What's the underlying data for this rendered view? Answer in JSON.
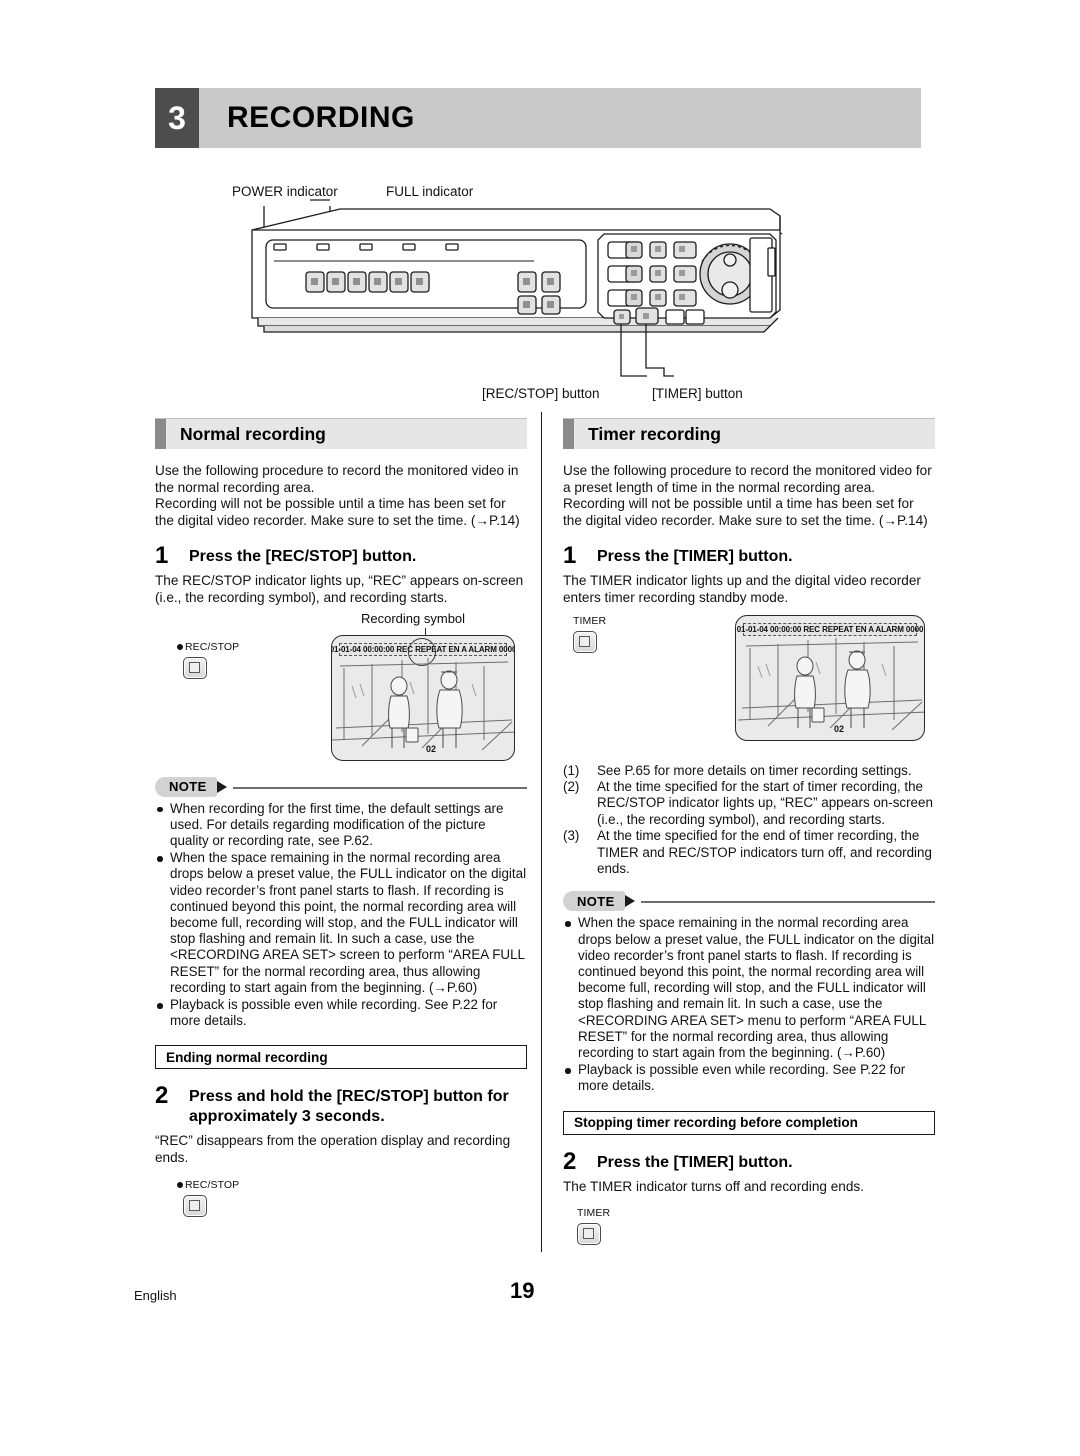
{
  "chapter": {
    "number": "3",
    "title": "RECORDING"
  },
  "figure": {
    "callouts": {
      "power": "POWER indicator",
      "full": "FULL indicator",
      "rec_stop": "[REC/STOP] button",
      "timer": "[TIMER] button"
    }
  },
  "left": {
    "heading": "Normal recording",
    "intro1": "Use the following procedure to record the monitored video in the normal recording area.",
    "intro2": "Recording will not be possible until a time has been set for the digital video recorder. Make sure to set the time. (→P.14)",
    "step1": {
      "number": "1",
      "label": "Press the [REC/STOP] button."
    },
    "step1_body": "The REC/STOP indicator lights up, “REC” appears on-screen (i.e., the recording symbol), and recording starts.",
    "recording_symbol_label": "Recording symbol",
    "button_label": "REC/STOP",
    "osd": "01-01-04 00:00:00 REC REPEAT EN A ALARM 0000",
    "camera_number": "02",
    "note": {
      "badge": "NOTE",
      "items": [
        "When recording for the first time, the default settings are used. For details regarding modification of the picture quality or recording rate, see P.62.",
        "When the space remaining in the normal recording area drops below a preset value, the FULL indicator on the digital video recorder’s front panel starts to flash. If recording is continued beyond this point, the normal recording area will become full, recording will stop, and the FULL indicator will stop flashing and remain lit. In such a case, use the <RECORDING AREA SET> screen to perform “AREA FULL RESET” for the normal recording area, thus allowing recording to start again from the beginning. (→P.60)",
        "Playback is possible even while recording. See P.22 for more details."
      ]
    },
    "subsection": "Ending normal recording",
    "step2": {
      "number": "2",
      "label": "Press and hold the [REC/STOP] button for approximately 3 seconds."
    },
    "step2_body": "“REC” disappears from the operation display and recording ends.",
    "button_label2": "REC/STOP"
  },
  "right": {
    "heading": "Timer recording",
    "intro1": "Use the following procedure to record the monitored video for a preset length of time in the normal recording area.",
    "intro2": "Recording will not be possible until a time has been set for the digital video recorder. Make sure to set the time. (→P.14)",
    "step1": {
      "number": "1",
      "label": "Press the [TIMER] button."
    },
    "step1_body": "The TIMER indicator lights up and the digital video recorder enters timer recording standby mode.",
    "button_label": "TIMER",
    "osd": "01-01-04 00:00:00 REC REPEAT EN A ALARM 0000",
    "camera_number": "02",
    "numbered": [
      {
        "n": "(1)",
        "text": "See P.65 for more details on timer recording settings."
      },
      {
        "n": "(2)",
        "text": "At the time specified for the start of timer recording, the REC/STOP indicator lights up, “REC” appears on-screen (i.e., the recording symbol), and recording starts."
      },
      {
        "n": "(3)",
        "text": "At the time specified for the end of timer recording, the TIMER and REC/STOP indicators turn off, and recording ends."
      }
    ],
    "note": {
      "badge": "NOTE",
      "items": [
        "When the space remaining in the normal recording area drops below a preset value, the FULL indicator on the digital video recorder’s front panel starts to flash. If recording is continued beyond this point, the normal recording area will become full, recording will stop, and the FULL indicator will stop flashing and remain lit. In such a case, use the <RECORDING AREA SET> menu to perform “AREA FULL RESET” for the normal recording area, thus allowing recording to start again from the beginning. (→P.60)",
        "Playback is possible even while recording. See P.22 for more details."
      ]
    },
    "subsection": "Stopping timer recording before completion",
    "step2": {
      "number": "2",
      "label": "Press the [TIMER] button."
    },
    "step2_body": "The TIMER indicator turns off and recording ends.",
    "button_label2": "TIMER"
  },
  "footer": {
    "language": "English",
    "page": "19"
  }
}
